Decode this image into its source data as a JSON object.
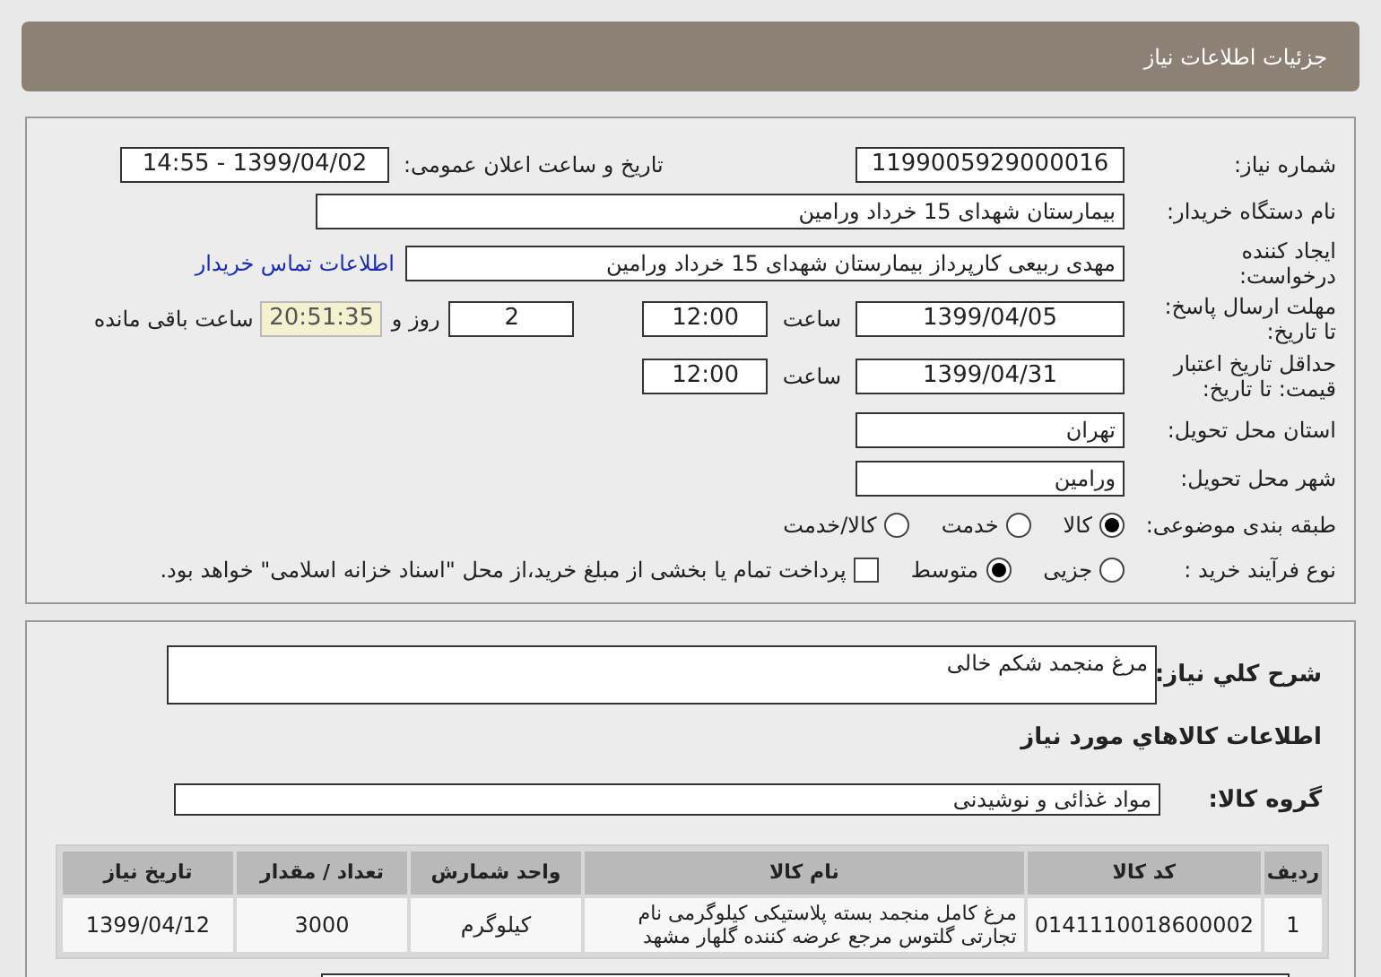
{
  "header": {
    "title": "جزئیات اطلاعات نیاز"
  },
  "need_number": {
    "label": "شماره نیاز:",
    "value": "1199005929000016"
  },
  "announce": {
    "label": "تاریخ و ساعت اعلان عمومی:",
    "value": "1399/04/02 - 14:55"
  },
  "buyer": {
    "label": "نام دستگاه خریدار:",
    "value": "بیمارستان شهدای 15 خرداد ورامین"
  },
  "creator": {
    "label_lines": [
      "ایجاد کننده",
      "درخواست:"
    ],
    "value": "مهدی ربیعی کارپرداز بیمارستان شهدای 15 خرداد ورامین",
    "link": "اطلاعات تماس خریدار"
  },
  "deadline": {
    "label_lines": [
      "مهلت ارسال پاسخ:",
      "تا تاریخ:"
    ],
    "date": "1399/04/05",
    "time_label": "ساعت",
    "time": "12:00",
    "days": "2",
    "days_label": "روز و",
    "remaining": "20:51:35",
    "remaining_label": "ساعت باقی مانده"
  },
  "validity": {
    "label_lines": [
      "حداقل تاریخ اعتبار",
      "قیمت: تا تاریخ:"
    ],
    "date": "1399/04/31",
    "time_label": "ساعت",
    "time": "12:00"
  },
  "province": {
    "label": "استان محل تحویل:",
    "value": "تهران"
  },
  "city": {
    "label": "شهر محل تحویل:",
    "value": "ورامین"
  },
  "category": {
    "label": "طبقه بندی موضوعی:",
    "options": [
      {
        "label": "کالا",
        "selected": true
      },
      {
        "label": "خدمت",
        "selected": false
      },
      {
        "label": "کالا/خدمت",
        "selected": false
      }
    ]
  },
  "purchase_type": {
    "label": "نوع فرآیند خرید :",
    "options": [
      {
        "label": "جزیی",
        "selected": false
      },
      {
        "label": "متوسط",
        "selected": true
      }
    ],
    "treasury": {
      "label": "پرداخت تمام یا بخشی از مبلغ خرید،از محل \"اسناد خزانه اسلامی\" خواهد بود.",
      "checked": false
    }
  },
  "summary": {
    "label": "شرح کلي نياز:",
    "value": "مرغ منجمد شکم خالی"
  },
  "goods_title": "اطلاعات کالاهاي مورد نياز",
  "goods_group": {
    "label": "گروه کالا:",
    "value": "مواد غذائی و نوشیدنی"
  },
  "table": {
    "columns": [
      "ردیف",
      "کد کالا",
      "نام کالا",
      "واحد شمارش",
      "تعداد / مقدار",
      "تاریخ نیاز"
    ],
    "rows": [
      [
        "1",
        "0141110018600002",
        "مرغ کامل منجمد بسته پلاستیکی کیلوگرمی نام تجارتی گلتوس مرجع عرضه کننده گلهار مشهد",
        "کیلوگرم",
        "3000",
        "1399/04/12"
      ]
    ]
  }
}
